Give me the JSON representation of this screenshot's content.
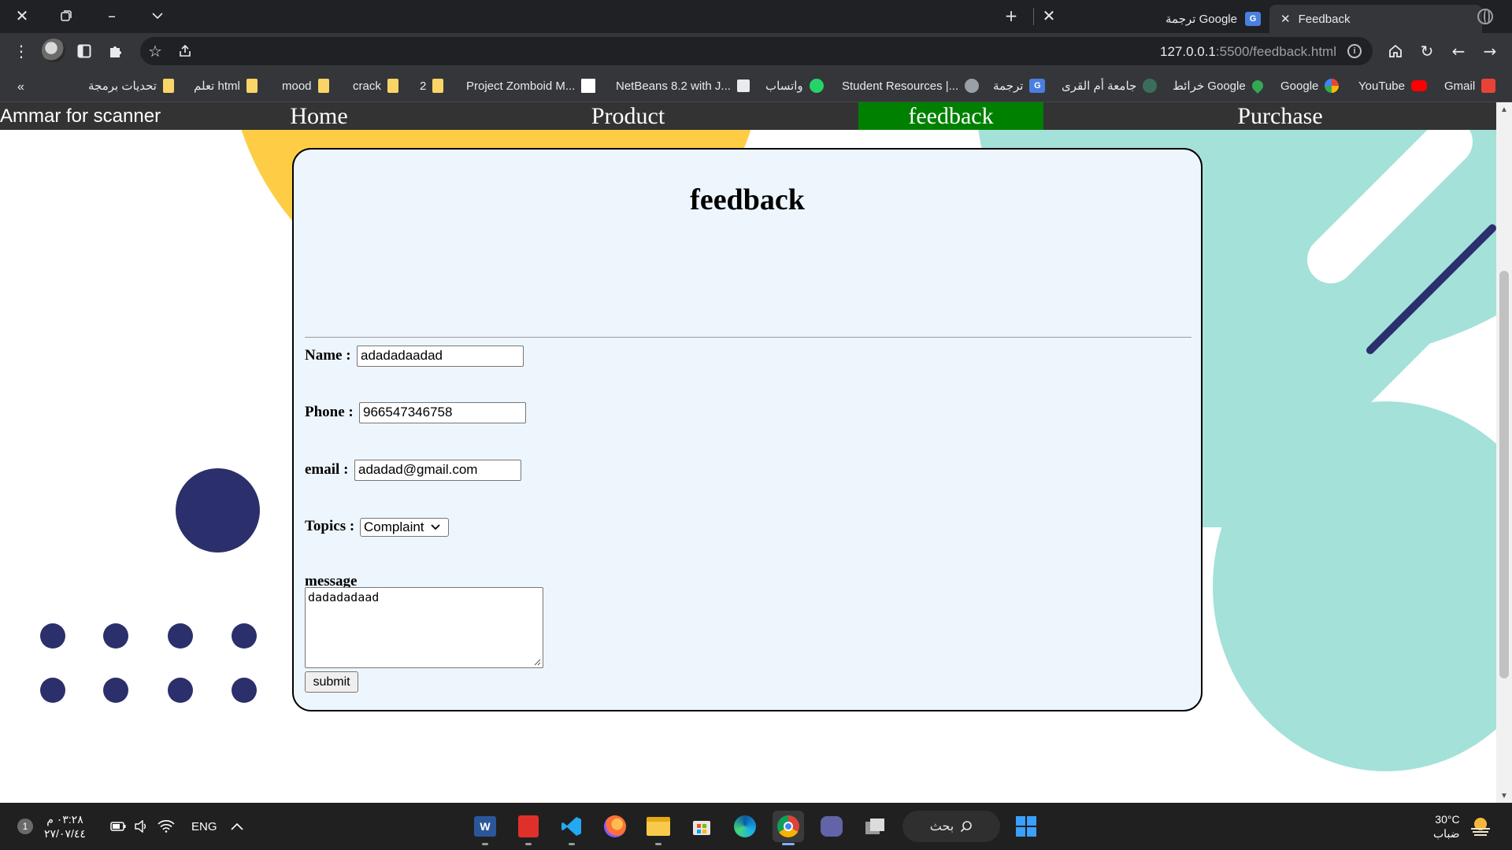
{
  "browser": {
    "tabs": [
      {
        "title": "Feedback",
        "active": true
      },
      {
        "title": "ترجمة Google",
        "active": false
      }
    ],
    "new_tab_symbol": "+",
    "url_host": "127.0.0.1",
    "url_rest": ":5500/feedback.html",
    "bookmarks": [
      {
        "label": "Gmail",
        "icon": "gmail-icon"
      },
      {
        "label": "YouTube",
        "icon": "youtube-icon"
      },
      {
        "label": "Google",
        "icon": "google-icon"
      },
      {
        "label": "خرائط Google",
        "icon": "maps-icon"
      },
      {
        "label": "جامعة أم القرى",
        "icon": "university-icon"
      },
      {
        "label": "ترجمة",
        "icon": "translate-icon"
      },
      {
        "label": "Student Resources |...",
        "icon": "globe-icon"
      },
      {
        "label": "واتساب",
        "icon": "whatsapp-icon"
      },
      {
        "label": "NetBeans 8.2 with J...",
        "icon": "bank-icon"
      },
      {
        "label": "Project Zomboid M...",
        "icon": "page-icon"
      },
      {
        "label": "2",
        "icon": "folder-icon"
      },
      {
        "label": "crack",
        "icon": "folder-icon"
      },
      {
        "label": "mood",
        "icon": "folder-icon"
      },
      {
        "label": "تعلم html",
        "icon": "folder-icon"
      },
      {
        "label": "تحديات برمجة",
        "icon": "folder-icon"
      }
    ],
    "bookmarks_overflow": "«"
  },
  "site": {
    "brand": "Ammar for scanner",
    "nav": [
      {
        "label": "Home",
        "active": false
      },
      {
        "label": "Product",
        "active": false
      },
      {
        "label": "feedback",
        "active": true
      },
      {
        "label": "Purchase",
        "active": false
      }
    ],
    "colors": {
      "nav_bg": "#333333",
      "nav_active": "#008000",
      "card_bg": "#eef6fd",
      "yellow": "#fecd45",
      "teal": "#a3e1d9",
      "navy": "#2b2f6b"
    }
  },
  "form": {
    "title": "feedback",
    "name_label": "Name :",
    "name_value": "adadadaadad",
    "phone_label": "Phone :",
    "phone_value": "966547346758",
    "email_label": "email :",
    "email_value": "adadad@gmail.com",
    "topics_label": "Topics :",
    "topics_value": "Complaint",
    "message_label": "message",
    "message_value": "dadadadaad",
    "submit_label": "submit"
  },
  "taskbar": {
    "time": "٠٣:٢٨ م",
    "date": "٢٧/٠٧/٤٤",
    "lang": "ENG",
    "search_label": "بحث",
    "weather_temp": "30°C",
    "weather_desc": "ضباب",
    "notification_count": "1",
    "apps": [
      "word-icon",
      "acrobat-icon",
      "vscode-icon",
      "firefox-icon",
      "file-explorer-icon",
      "store-icon",
      "edge-icon",
      "chrome-icon",
      "teams-icon",
      "task-view-icon"
    ]
  }
}
